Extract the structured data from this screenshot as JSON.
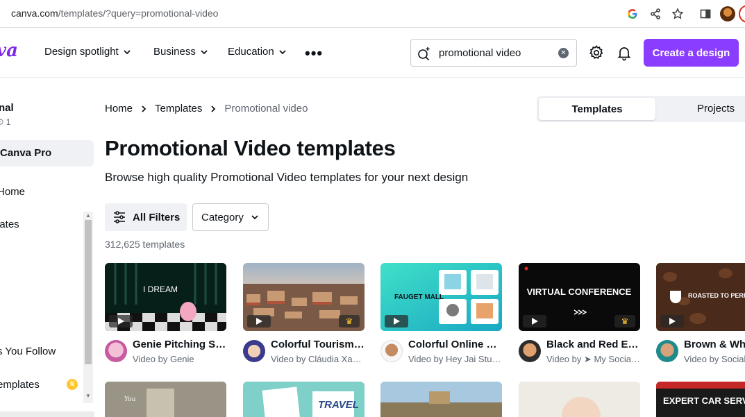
{
  "browser": {
    "url_domain": "canva.com",
    "url_path": "/templates/?query=promotional-video"
  },
  "header": {
    "logo": "va",
    "nav": [
      "Design spotlight",
      "Business",
      "Education"
    ],
    "search_value": "promotional video",
    "create_button": "Create a design"
  },
  "sidebar": {
    "team_name": "nal",
    "members": "ꖴ 1",
    "pro_item": "Canva Pro",
    "links": [
      {
        "label": "Home"
      },
      {
        "label": "lates"
      },
      {
        "label": "s You Follow"
      },
      {
        "label": "emplates"
      }
    ]
  },
  "breadcrumb": [
    "Home",
    "Templates",
    "Promotional video"
  ],
  "toggle": {
    "active": "Templates",
    "inactive": "Projects"
  },
  "page": {
    "title": "Promotional Video templates",
    "subtitle": "Browse high quality Promotional Video templates for your next design",
    "filters_label": "All Filters",
    "category_label": "Category",
    "count": "312,625 templates"
  },
  "cards": [
    {
      "title": "Genie Pitching Sh...",
      "author": "Video by Genie",
      "thumb_text": "I DREAM",
      "premium": false
    },
    {
      "title": "Colorful Tourism i...",
      "author": "Video by Cláudia Xavi...",
      "thumb_text": "",
      "premium": true
    },
    {
      "title": "Colorful Online E-...",
      "author": "Video by Hey Jai Stud...",
      "thumb_text": "FAUGET MALL",
      "premium": false
    },
    {
      "title": "Black and Red Ed...",
      "author": "Video by ➤ My Social ...",
      "thumb_text": "VIRTUAL CONFERENCE",
      "premium": true
    },
    {
      "title": "Brown & White...",
      "author": "Video by Social...",
      "thumb_text": "ROASTED TO PERFE",
      "premium": false
    }
  ],
  "row2_texts": [
    "TRAVEL",
    "EXPERT CAR SERVICE"
  ]
}
